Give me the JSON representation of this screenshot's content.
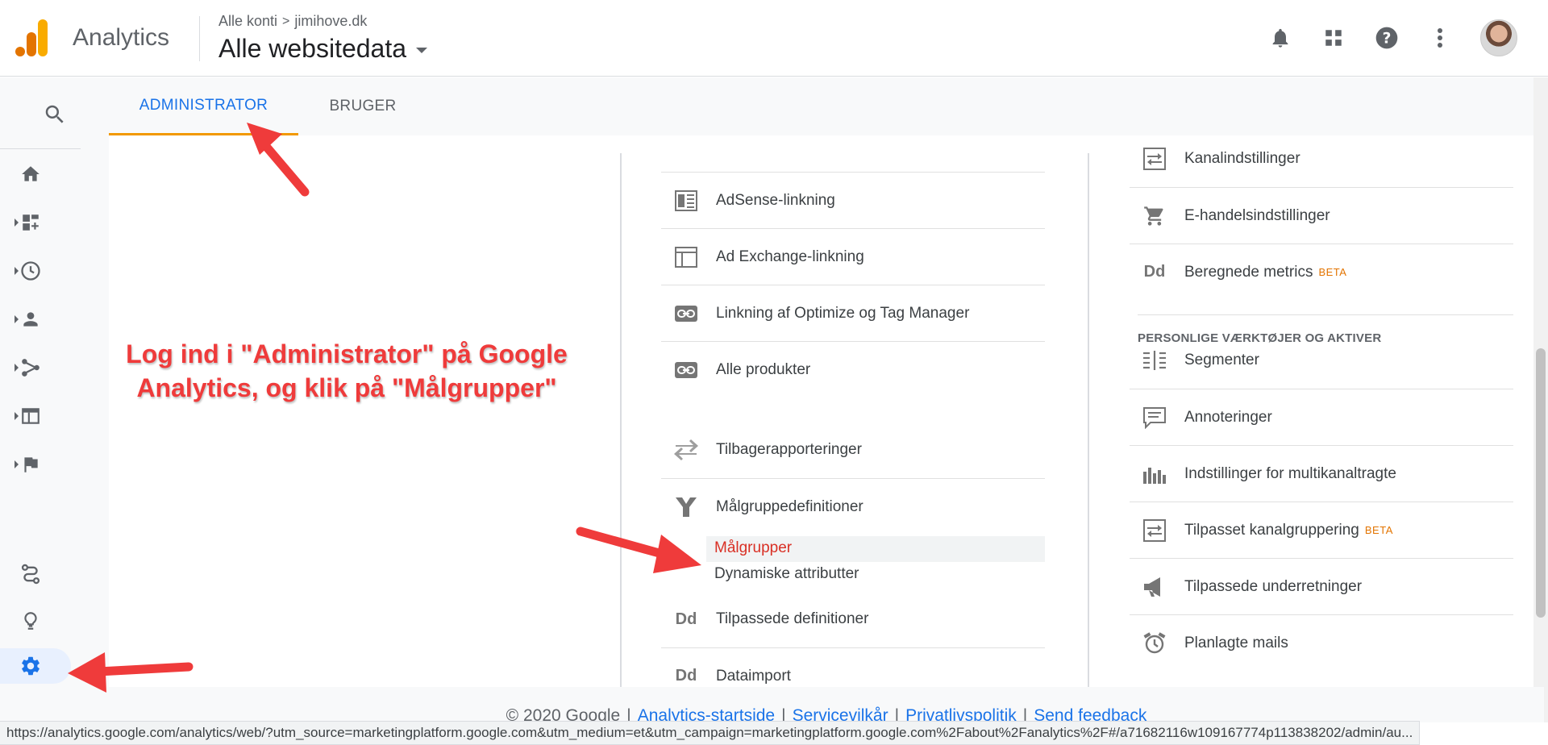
{
  "header": {
    "brand": "Analytics",
    "breadcrumb_account": "Alle konti",
    "breadcrumb_separator": ">",
    "breadcrumb_property": "jimihove.dk",
    "view_name": "Alle websitedata",
    "icons": [
      "notifications-icon",
      "apps-grid-icon",
      "help-icon",
      "more-vert-icon",
      "account-avatar"
    ]
  },
  "tabs": [
    {
      "label": "ADMINISTRATOR",
      "active": true
    },
    {
      "label": "BRUGER",
      "active": false
    }
  ],
  "left_nav": {
    "items": [
      "search-icon",
      "home-icon",
      "customization-icon",
      "realtime-icon",
      "audience-icon",
      "acquisition-icon",
      "behavior-icon",
      "conversions-icon",
      "attribution-icon",
      "discover-icon",
      "admin-gear-icon"
    ],
    "active": "admin-gear-icon"
  },
  "property_column": {
    "items": [
      {
        "icon": "adsense-icon",
        "label": "AdSense-linkning"
      },
      {
        "icon": "ad-exchange-icon",
        "label": "Ad Exchange-linkning"
      },
      {
        "icon": "link-icon",
        "label": "Linkning af Optimize og Tag Manager"
      },
      {
        "icon": "link-icon",
        "label": "Alle produkter"
      },
      {
        "icon": "postbacks-icon",
        "label": "Tilbagerapporteringer"
      },
      {
        "icon": "audience-definitions-icon",
        "label": "Målgruppedefinitioner"
      },
      {
        "icon": "dd-icon",
        "label": "Tilpassede definitioner"
      },
      {
        "icon": "dd-icon",
        "label": "Dataimport"
      }
    ],
    "sub_items": [
      {
        "label": "Målgrupper",
        "active": true
      },
      {
        "label": "Dynamiske attributter",
        "active": false
      }
    ]
  },
  "view_column": {
    "items_top": [
      {
        "icon": "channel-settings-icon",
        "label": "Kanalindstillinger",
        "beta": ""
      },
      {
        "icon": "cart-icon",
        "label": "E-handelsindstillinger",
        "beta": ""
      },
      {
        "icon": "dd-icon",
        "label": "Beregnede metrics",
        "beta": "BETA"
      }
    ],
    "section_title": "PERSONLIGE VÆRKTØJER OG AKTIVER",
    "items_bottom": [
      {
        "icon": "segments-icon",
        "label": "Segmenter",
        "beta": ""
      },
      {
        "icon": "annotations-icon",
        "label": "Annoteringer",
        "beta": ""
      },
      {
        "icon": "multichannel-icon",
        "label": "Indstillinger for multikanaltragte",
        "beta": ""
      },
      {
        "icon": "channel-grouping-icon",
        "label": "Tilpasset kanalgruppering",
        "beta": "BETA"
      },
      {
        "icon": "megaphone-icon",
        "label": "Tilpassede underretninger",
        "beta": ""
      },
      {
        "icon": "scheduled-mail-icon",
        "label": "Planlagte mails",
        "beta": ""
      }
    ]
  },
  "annotation": {
    "line1": "Log ind i \"Administrator\" på Google",
    "line2": "Analytics, og klik på \"Målgrupper\"",
    "color": "#ef3b3b"
  },
  "footer": {
    "copyright": "© 2020 Google",
    "links": [
      "Analytics-startside",
      "Servicevilkår",
      "Privatlivspolitik",
      "Send feedback"
    ],
    "separator": "|"
  },
  "status_url": "https://analytics.google.com/analytics/web/?utm_source=marketingplatform.google.com&utm_medium=et&utm_campaign=marketingplatform.google.com%2Fabout%2Fanalytics%2F#/a71682116w109167774p113838202/admin/au...",
  "colors": {
    "accent_blue": "#1a73e8",
    "tab_underline": "#f29900",
    "active_red": "#d93025",
    "beta_orange": "#e37400",
    "logo_orange": "#f9ab00",
    "logo_dark_orange": "#e37400"
  }
}
